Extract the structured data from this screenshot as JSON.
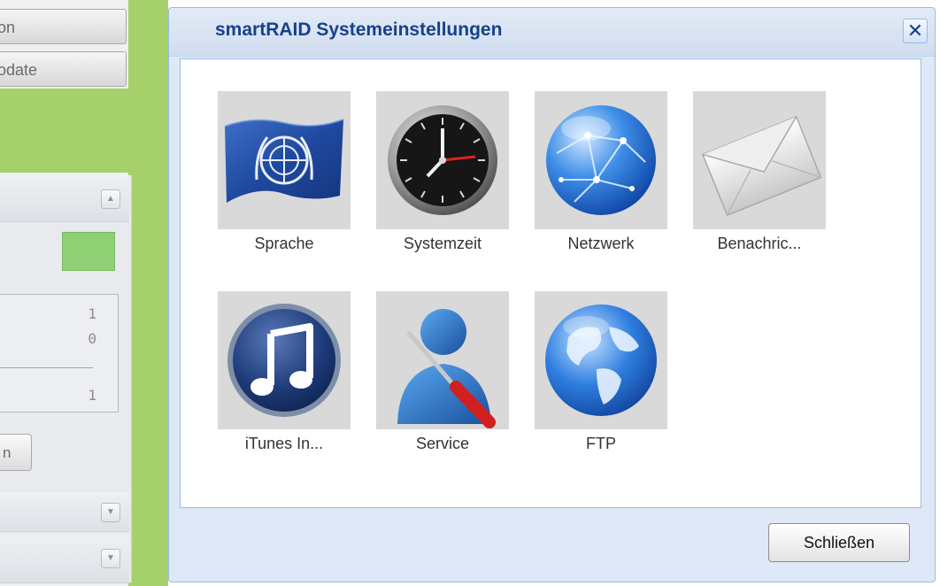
{
  "background_app": {
    "button_1_label": "on",
    "button_2_label": "odate",
    "counter_values": [
      "1",
      "0",
      "1"
    ],
    "small_button_label": "n",
    "status_color": "#8fd075",
    "accent_green": "#a6d16a"
  },
  "dialog": {
    "title": "smartRAID Systemeinstellungen",
    "close_glyph": "✕",
    "close_button_label": "Schließen",
    "title_color": "#15428b",
    "items": [
      {
        "label": "Sprache",
        "icon": "un-flag-icon"
      },
      {
        "label": "Systemzeit",
        "icon": "clock-icon"
      },
      {
        "label": "Netzwerk",
        "icon": "network-globe-icon"
      },
      {
        "label": "Benachric...",
        "icon": "envelope-icon"
      },
      {
        "label": "iTunes In...",
        "icon": "music-note-icon"
      },
      {
        "label": "Service",
        "icon": "service-user-screwdriver-icon"
      },
      {
        "label": "FTP",
        "icon": "earth-globe-icon"
      }
    ]
  }
}
